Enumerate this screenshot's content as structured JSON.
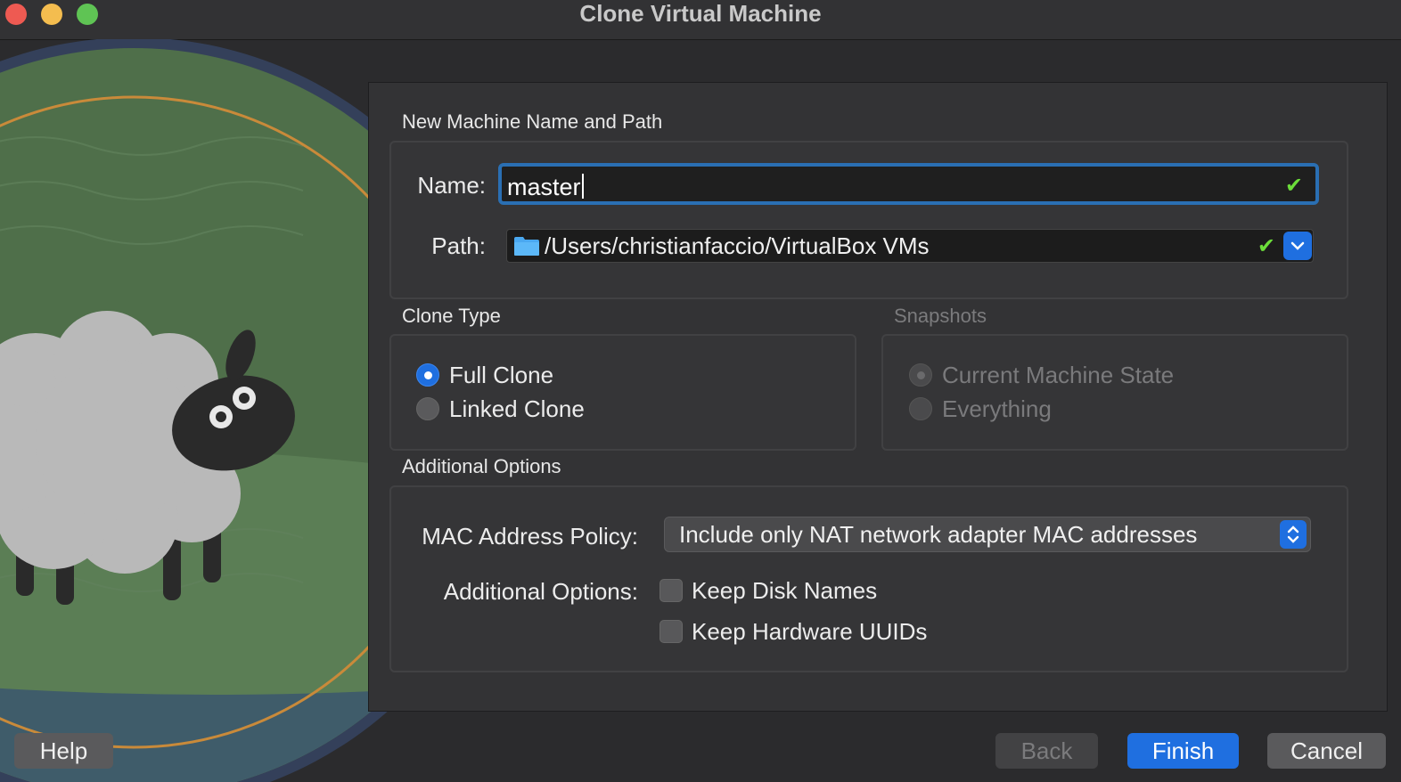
{
  "window": {
    "title": "Clone Virtual Machine"
  },
  "sections": {
    "name_path": "New Machine Name and Path",
    "clone_type": "Clone Type",
    "snapshots": "Snapshots",
    "additional": "Additional Options"
  },
  "name": {
    "label": "Name:",
    "value": "master"
  },
  "path": {
    "label": "Path:",
    "value": "/Users/christianfaccio/VirtualBox VMs"
  },
  "clone_type": {
    "options": [
      "Full Clone",
      "Linked Clone"
    ],
    "selected": "Full Clone"
  },
  "snapshots": {
    "options": [
      "Current Machine State",
      "Everything"
    ],
    "selected": "Current Machine State",
    "enabled": false
  },
  "mac_policy": {
    "label": "MAC Address Policy:",
    "value": "Include only NAT network adapter MAC addresses"
  },
  "additional_options": {
    "label": "Additional Options:",
    "keep_disk_names": "Keep Disk Names",
    "keep_hardware_uuids": "Keep Hardware UUIDs"
  },
  "buttons": {
    "help": "Help",
    "back": "Back",
    "finish": "Finish",
    "cancel": "Cancel"
  },
  "colors": {
    "accent": "#1f6fe0",
    "valid_check": "#6cdd3a",
    "name_focus": "#2a6fb3"
  }
}
